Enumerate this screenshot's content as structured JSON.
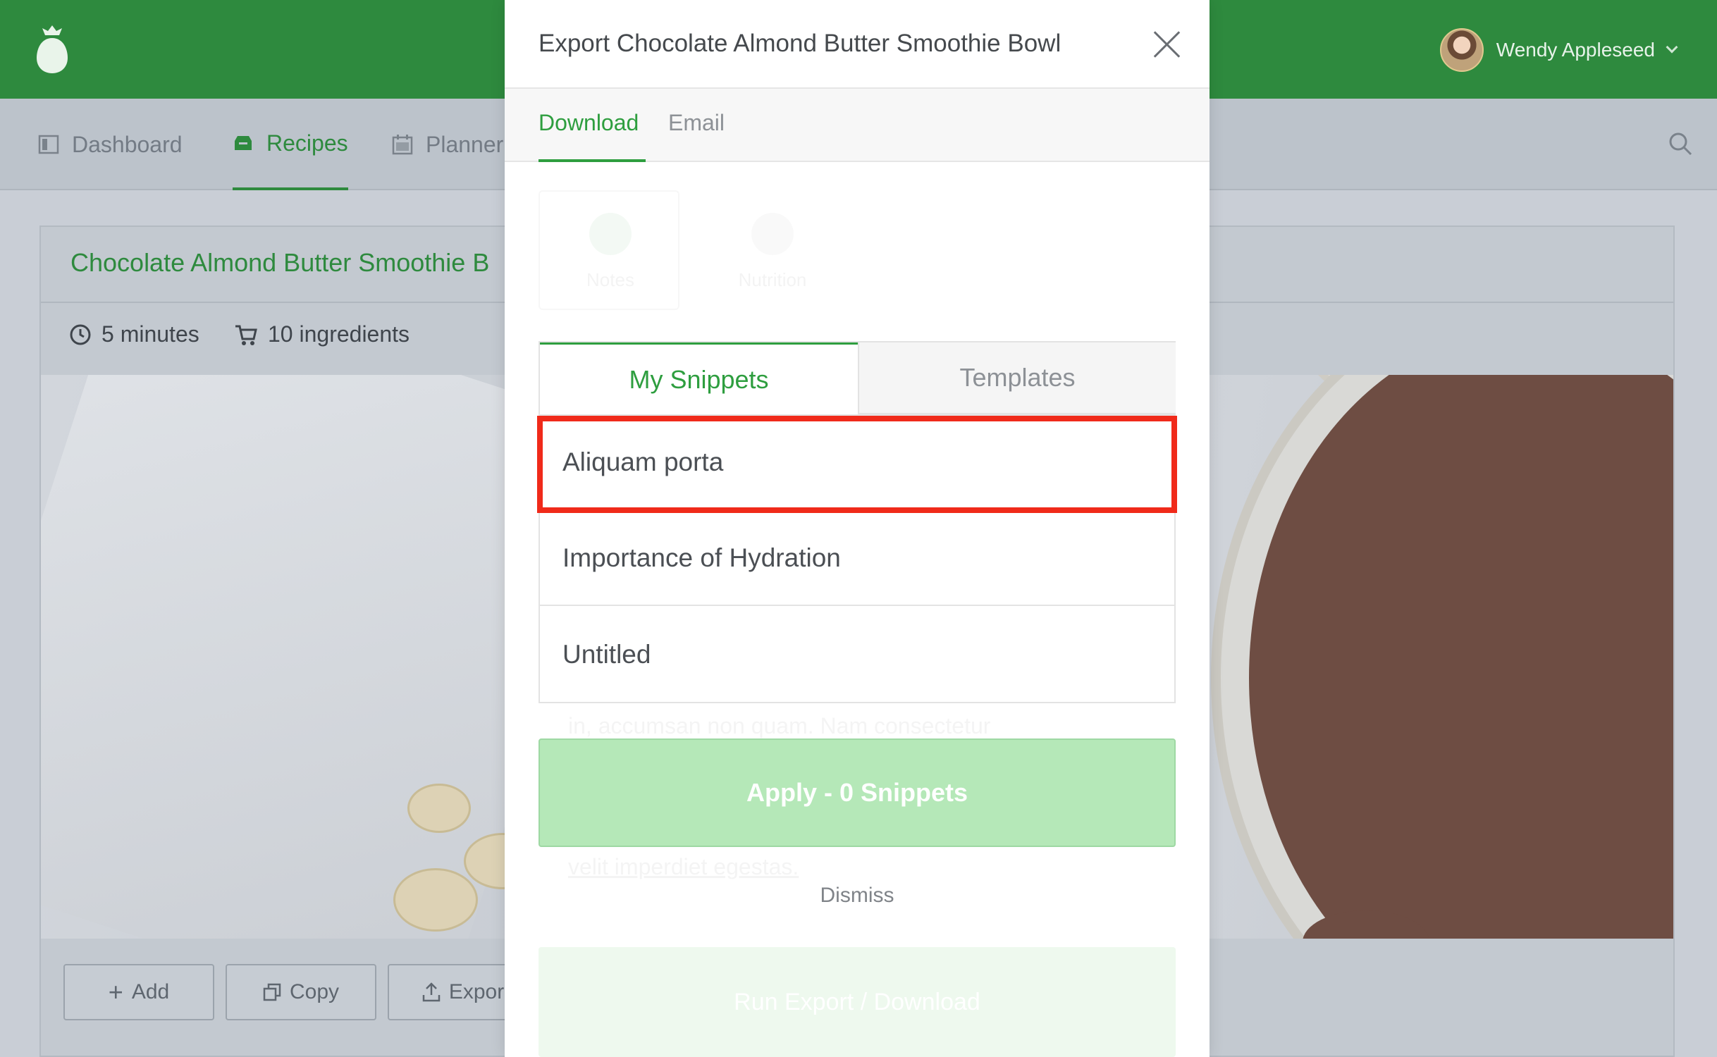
{
  "app": {
    "user_name": "Wendy Appleseed",
    "nav": [
      "Dashboard",
      "Recipes",
      "Planner"
    ]
  },
  "recipe": {
    "title": "Chocolate Almond Butter Smoothie B",
    "time": "5 minutes",
    "ingredients": "10 ingredients",
    "buttons": [
      "Add",
      "Copy",
      "Expor"
    ]
  },
  "modal": {
    "title": "Export Chocolate Almond Butter Smoothie Bowl",
    "tabs": [
      "Download",
      "Email"
    ],
    "faded_options": [
      "Notes",
      "Nutrition"
    ],
    "snippet_tabs": [
      "My Snippets",
      "Templates"
    ],
    "snippets": [
      "Aliquam porta",
      "Importance of Hydration",
      "Untitled"
    ],
    "ghost_lines": [
      "in, accumsan non quam. Nam consectetur",
      "velit imperdiet egestas."
    ],
    "apply_label": "Apply - 0 Snippets",
    "dismiss_label": "Dismiss",
    "faded_button_label": "Run Export / Download"
  },
  "colors": {
    "brand_green": "#2e8a3e",
    "highlight_red": "#f02a1a",
    "apply_green": "#b5e8b8"
  }
}
